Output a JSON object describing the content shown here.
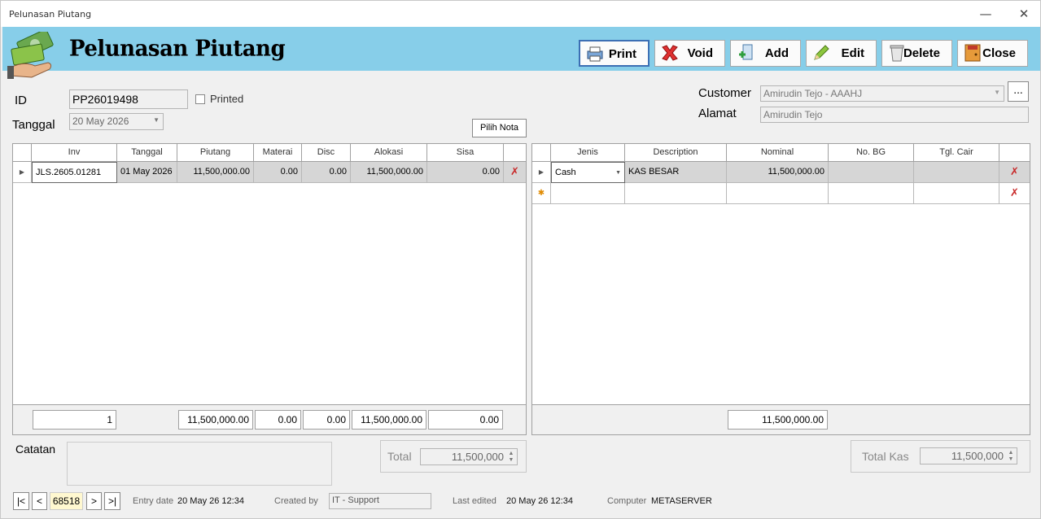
{
  "window": {
    "title": "Pelunasan Piutang",
    "minimize": "—",
    "close": "✕"
  },
  "header": {
    "title": "Pelunasan Piutang"
  },
  "toolbar": {
    "print": "Print",
    "void": "Void",
    "add": "Add",
    "edit": "Edit",
    "delete": "Delete",
    "close": "Close"
  },
  "form": {
    "id_label": "ID",
    "id_value": "PP26019498",
    "printed_label": "Printed",
    "tanggal_label": "Tanggal",
    "tanggal_value": "20 May 2026",
    "pilih_nota": "Pilih Nota",
    "customer_label": "Customer",
    "customer_value": "Amirudin Tejo - AAAHJ",
    "customer_btn": "...",
    "alamat_label": "Alamat",
    "alamat_value": "Amirudin Tejo"
  },
  "left_grid": {
    "columns": [
      "Inv",
      "Tanggal",
      "Piutang",
      "Materai",
      "Disc",
      "Alokasi",
      "Sisa"
    ],
    "rows": [
      {
        "inv": "JLS.2605.01281",
        "tanggal": "01 May 2026",
        "piutang": "11,500,000.00",
        "materai": "0.00",
        "disc": "0.00",
        "alokasi": "11,500,000.00",
        "sisa": "0.00"
      }
    ],
    "footer": {
      "count": "1",
      "piutang": "11,500,000.00",
      "materai": "0.00",
      "disc": "0.00",
      "alokasi": "11,500,000.00",
      "sisa": "0.00"
    }
  },
  "right_grid": {
    "columns": [
      "Jenis",
      "Description",
      "Nominal",
      "No. BG",
      "Tgl. Cair"
    ],
    "rows": [
      {
        "jenis": "Cash",
        "description": "KAS BESAR",
        "nominal": "11,500,000.00",
        "no_bg": "",
        "tgl_cair": ""
      }
    ],
    "footer": {
      "nominal": "11,500,000.00"
    }
  },
  "catatan_label": "Catatan",
  "total": {
    "label": "Total",
    "value": "11,500,000"
  },
  "total_kas": {
    "label": "Total Kas",
    "value": "11,500,000"
  },
  "statusbar": {
    "nav_first": "|<",
    "nav_prev": "<",
    "record": "68518",
    "nav_next": ">",
    "nav_last": ">|",
    "entry_label": "Entry date",
    "entry_value": "20 May 26 12:34",
    "created_label": "Created by",
    "created_value": "IT - Support",
    "edited_label": "Last edited",
    "edited_value": "20 May 26 12:34",
    "computer_label": "Computer",
    "computer_value": "METASERVER"
  },
  "colors": {
    "header_bg": "#87cee9",
    "selected_row": "#d6d6d6",
    "delete_x": "#c82828"
  }
}
